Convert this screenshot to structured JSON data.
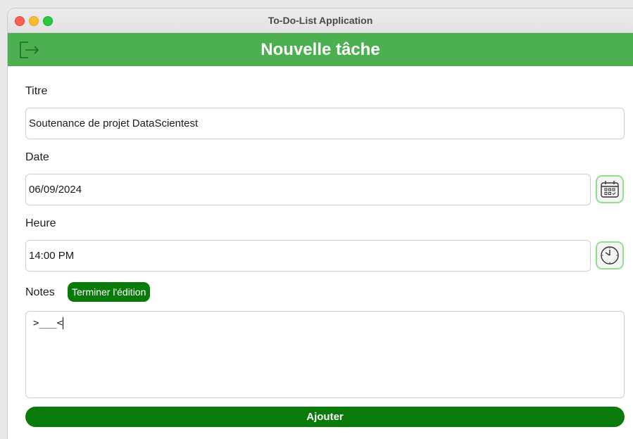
{
  "window": {
    "title": "To-Do-List Application"
  },
  "header": {
    "title": "Nouvelle tâche",
    "logout_icon": "logout-icon",
    "color": "#4caf50"
  },
  "form": {
    "title_label": "Titre",
    "title_value": "Soutenance de projet DataScientest",
    "date_label": "Date",
    "date_value": "06/09/2024",
    "date_picker_icon": "calendar-icon",
    "time_label": "Heure",
    "time_value": "14:00 PM",
    "time_picker_icon": "clock-icon",
    "notes_label": "Notes",
    "finish_editing_label": "Terminer l'édition",
    "notes_value": ">___<",
    "submit_label": "Ajouter"
  },
  "colors": {
    "accent": "#0a7a0a",
    "picker_border": "#8fe08f"
  }
}
